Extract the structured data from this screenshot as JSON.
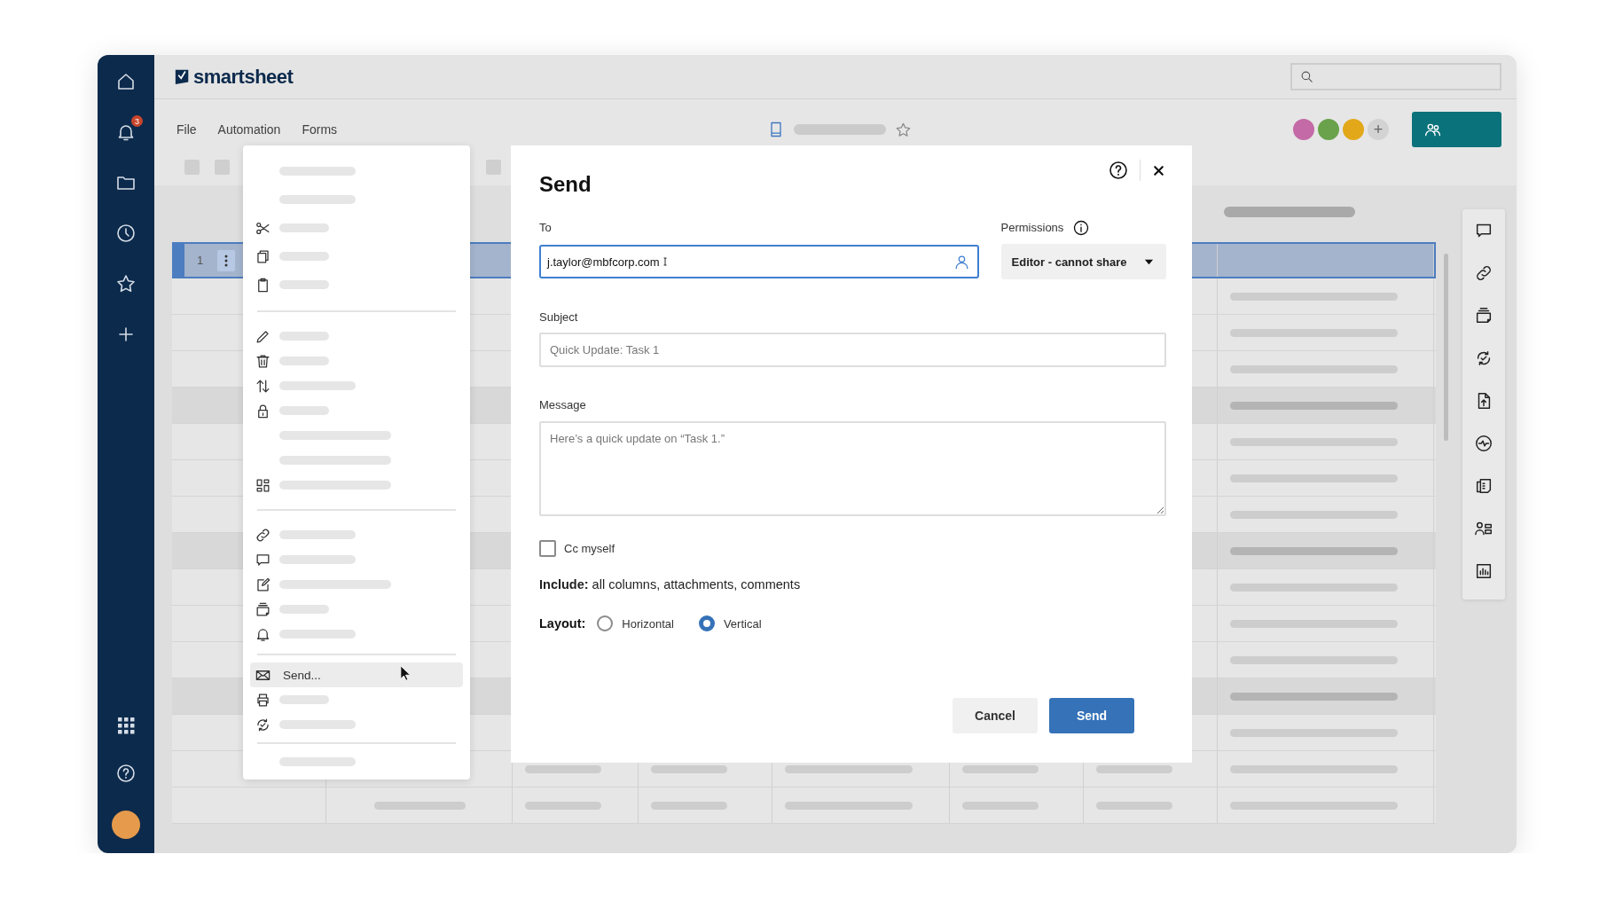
{
  "sidebar": {
    "notification_badge": "3"
  },
  "header": {
    "logo": "smartsheet"
  },
  "menu": [
    "File",
    "Automation",
    "Forms"
  ],
  "collaborators": [
    {
      "color": "#c46aa6"
    },
    {
      "color": "#6aa24c"
    },
    {
      "color": "#e2a81a"
    }
  ],
  "add_collaborator": "+",
  "grid": {
    "rows": [
      {
        "number": "1",
        "selected": true,
        "shaded": false
      },
      {
        "selected": false,
        "shaded": false
      },
      {
        "selected": false,
        "shaded": false
      },
      {
        "selected": false,
        "shaded": false
      },
      {
        "selected": false,
        "shaded": true
      },
      {
        "selected": false,
        "shaded": false
      },
      {
        "selected": false,
        "shaded": false
      },
      {
        "selected": false,
        "shaded": false
      },
      {
        "selected": false,
        "shaded": true
      },
      {
        "selected": false,
        "shaded": false
      },
      {
        "selected": false,
        "shaded": false
      },
      {
        "selected": false,
        "shaded": false
      },
      {
        "selected": false,
        "shaded": true
      },
      {
        "selected": false,
        "shaded": false
      },
      {
        "selected": false,
        "shaded": false
      },
      {
        "selected": false,
        "shaded": false
      }
    ]
  },
  "context_menu": {
    "items": [
      {
        "kind": "bar",
        "selected": false
      },
      {
        "kind": "bar",
        "selected": false
      },
      {
        "kind": "bar",
        "selected": false
      },
      {
        "kind": "bar",
        "selected": false
      },
      {
        "kind": "bar",
        "selected": false
      },
      {
        "kind": "divider"
      },
      {
        "kind": "bar",
        "selected": false
      },
      {
        "kind": "bar",
        "selected": false
      },
      {
        "kind": "bar",
        "selected": false
      },
      {
        "kind": "bar",
        "selected": false
      },
      {
        "kind": "bar",
        "selected": false
      },
      {
        "kind": "bar",
        "selected": false
      },
      {
        "kind": "bar",
        "selected": false
      },
      {
        "kind": "divider"
      },
      {
        "kind": "bar",
        "selected": false
      },
      {
        "kind": "bar",
        "selected": false
      },
      {
        "kind": "bar",
        "selected": false
      },
      {
        "kind": "bar",
        "selected": false
      },
      {
        "kind": "bar",
        "selected": false
      },
      {
        "kind": "divider"
      },
      {
        "kind": "entry",
        "label": "Send...",
        "selected": true
      },
      {
        "kind": "bar",
        "selected": false
      },
      {
        "kind": "bar",
        "selected": false
      },
      {
        "kind": "divider"
      },
      {
        "kind": "bar",
        "selected": false
      }
    ]
  },
  "dialog": {
    "title": "Send",
    "to": {
      "label": "To",
      "value": "j.taylor@mbfcorp.com"
    },
    "permissions": {
      "label": "Permissions",
      "value": "Editor - cannot share"
    },
    "subject": {
      "label": "Subject",
      "placeholder": "Quick Update: Task 1"
    },
    "message": {
      "label": "Message",
      "placeholder": "Here’s a quick update on “Task 1.”"
    },
    "cc_myself": {
      "label": "Cc myself",
      "checked": false
    },
    "include": "**Include:** all columns, attachments, comments",
    "layout": {
      "label": "Layout:",
      "options": [
        {
          "label": "Horizontal",
          "selected": false
        },
        {
          "label": "Vertical",
          "selected": true
        }
      ]
    },
    "buttons": [
      {
        "label": "Cancel",
        "kind": "secondary"
      },
      {
        "label": "Send",
        "kind": "primary"
      }
    ]
  }
}
